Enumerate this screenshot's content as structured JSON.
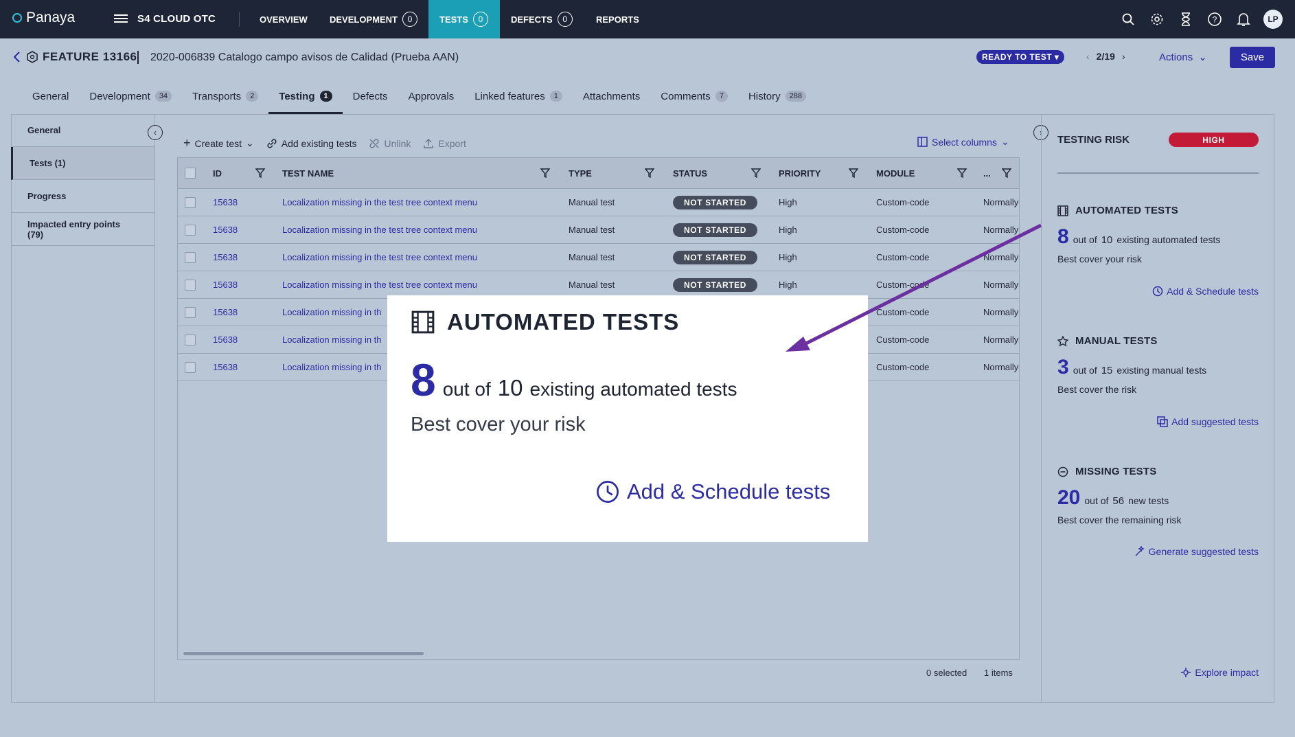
{
  "topbar": {
    "logo": "Panaya",
    "project": "S4 CLOUD OTC",
    "nav": [
      {
        "label": "OVERVIEW",
        "badge": ""
      },
      {
        "label": "DEVELOPMENT",
        "badge": "0"
      },
      {
        "label": "TESTS",
        "badge": "0"
      },
      {
        "label": "DEFECTS",
        "badge": "0"
      },
      {
        "label": "REPORTS",
        "badge": ""
      }
    ],
    "avatar": "LP"
  },
  "header": {
    "feature": "FEATURE 13166",
    "title": "2020-006839 Catalogo campo avisos de Calidad (Prueba AAN)",
    "status": "READY TO TEST",
    "pager": "2/19",
    "actions": "Actions",
    "save": "Save"
  },
  "tabs": [
    {
      "label": "General",
      "count": ""
    },
    {
      "label": "Development",
      "count": "34"
    },
    {
      "label": "Transports",
      "count": "2"
    },
    {
      "label": "Testing",
      "count": "1"
    },
    {
      "label": "Defects",
      "count": ""
    },
    {
      "label": "Approvals",
      "count": ""
    },
    {
      "label": "Linked features",
      "count": "1"
    },
    {
      "label": "Attachments",
      "count": ""
    },
    {
      "label": "Comments",
      "count": "7"
    },
    {
      "label": "History",
      "count": "288"
    }
  ],
  "leftnav": [
    "General",
    "Tests (1)",
    "Progress",
    "Impacted entry points (79)"
  ],
  "toolbar": {
    "create": "Create test",
    "add": "Add existing tests",
    "unlink": "Unlink",
    "export": "Export",
    "select_columns": "Select columns"
  },
  "grid": {
    "headers": {
      "id": "ID",
      "name": "TEST NAME",
      "type": "TYPE",
      "status": "STATUS",
      "priority": "PRIORITY",
      "module": "MODULE",
      "more": "..."
    },
    "rows": [
      {
        "id": "15638",
        "name": "Localization missing in the test tree context menu",
        "type": "Manual test",
        "status": "NOT STARTED",
        "priority": "High",
        "module": "Custom-code",
        "extra": "Normally"
      },
      {
        "id": "15638",
        "name": "Localization missing in the test tree context menu",
        "type": "Manual test",
        "status": "NOT STARTED",
        "priority": "High",
        "module": "Custom-code",
        "extra": "Normally"
      },
      {
        "id": "15638",
        "name": "Localization missing in the test tree context menu",
        "type": "Manual test",
        "status": "NOT STARTED",
        "priority": "High",
        "module": "Custom-code",
        "extra": "Normally"
      },
      {
        "id": "15638",
        "name": "Localization missing in the test tree context menu",
        "type": "Manual test",
        "status": "NOT STARTED",
        "priority": "High",
        "module": "Custom-code",
        "extra": "Normally"
      },
      {
        "id": "15638",
        "name": "Localization missing in th",
        "type": "",
        "status": "",
        "priority": "",
        "module": "Custom-code",
        "extra": "Normally"
      },
      {
        "id": "15638",
        "name": "Localization missing in th",
        "type": "",
        "status": "",
        "priority": "",
        "module": "Custom-code",
        "extra": "Normally"
      },
      {
        "id": "15638",
        "name": "Localization missing in th",
        "type": "",
        "status": "",
        "priority": "",
        "module": "Custom-code",
        "extra": "Normally"
      }
    ],
    "selected": "0 selected",
    "items": "1 items"
  },
  "risk": {
    "title": "TESTING RISK",
    "level": "HIGH",
    "automated": {
      "title": "AUTOMATED TESTS",
      "count": "8",
      "out_of": "out of",
      "total": "10",
      "desc": "existing automated tests",
      "sub": "Best cover your risk",
      "link": "Add & Schedule tests"
    },
    "manual": {
      "title": "MANUAL TESTS",
      "count": "3",
      "out_of": "out of",
      "total": "15",
      "desc": "existing manual tests",
      "sub": "Best cover the risk",
      "link": "Add suggested tests"
    },
    "missing": {
      "title": "MISSING TESTS",
      "count": "20",
      "out_of": "out of",
      "total": "56",
      "desc": "new tests",
      "sub": "Best cover the remaining risk",
      "link": "Generate suggested tests"
    },
    "explore": "Explore impact"
  },
  "zoom": {
    "title": "AUTOMATED TESTS",
    "count": "8",
    "out_of": "out of",
    "total": "10",
    "desc": "existing automated tests",
    "sub": "Best cover your risk",
    "link": "Add & Schedule tests"
  },
  "colors": {
    "topbar": "#1d2536",
    "active_nav": "#1a9fb6",
    "accent": "#2b2ca3",
    "risk_high": "#c31a37",
    "arrow": "#6b2fa0",
    "background": "#b9c6d6"
  }
}
